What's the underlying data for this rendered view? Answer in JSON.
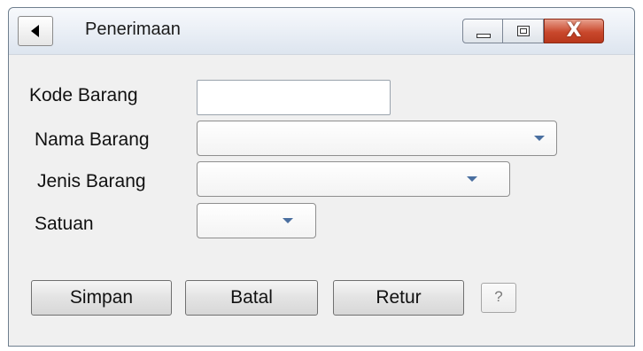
{
  "window": {
    "title": "Penerimaan",
    "controls": {
      "minimize": "minimize",
      "maximize": "maximize",
      "close": "X"
    }
  },
  "form": {
    "fields": [
      {
        "label": "Kode Barang",
        "type": "text",
        "value": ""
      },
      {
        "label": "Nama Barang",
        "type": "combo",
        "value": ""
      },
      {
        "label": "Jenis Barang",
        "type": "combo",
        "value": ""
      },
      {
        "label": "Satuan",
        "type": "combo",
        "value": ""
      }
    ]
  },
  "buttons": {
    "simpan": "Simpan",
    "batal": "Batal",
    "retur": "Retur",
    "help": "?"
  },
  "colors": {
    "window_bg": "#f0f0f0",
    "close_button": "#c9482c",
    "combo_arrow": "#4a6fa0"
  }
}
